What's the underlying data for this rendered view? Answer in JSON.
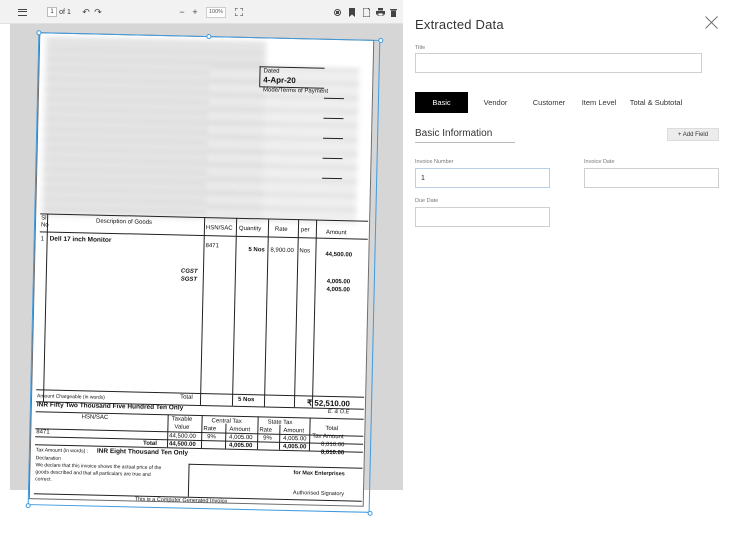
{
  "toolbar": {
    "page_current": "1",
    "page_of": "of 1",
    "zoom": "100%",
    "minus": "−",
    "plus": "+",
    "undo": "↶",
    "redo": "↷"
  },
  "document": {
    "dated_label": "Dated",
    "dated_value": "4-Apr-20",
    "mode_label": "Mode/Terms of Payment",
    "col_sl": "Sl",
    "col_no": "No",
    "col_desc": "Description of Goods",
    "col_hsn": "HSN/SAC",
    "col_qty": "Quantity",
    "col_rate": "Rate",
    "col_per": "per",
    "col_amount": "Amount",
    "item_no": "1",
    "item_desc": "Dell 17 inch Monitor",
    "item_hsn": "8471",
    "item_qty": "5 Nos",
    "item_rate": "8,900.00",
    "item_per": "Nos",
    "item_amount": "44,500.00",
    "cgst": "CGST",
    "sgst": "SGST",
    "cgst_amt": "4,005.00",
    "sgst_amt": "4,005.00",
    "total_label": "Total",
    "total_qty": "5 Nos",
    "total_amount": "₹ 52,510.00",
    "chargeable": "Amount Chargeable (in words)",
    "eoe": "E. & O.E",
    "words": "INR Fifty Two Thousand Five Hundred Ten Only",
    "t_hsn": "HSN/SAC",
    "t_taxable": "Taxable",
    "t_value": "Value",
    "t_central": "Central Tax",
    "t_state": "State Tax",
    "t_rate": "Rate",
    "t_amount": "Amount",
    "t_total": "Total",
    "t_taxamount": "Tax Amount",
    "t_hsn_val": "8471",
    "t_taxable_val": "44,500.00",
    "t_rate_val": "9%",
    "t_amt_val": "4,005.00",
    "t_total_val": "8,010.00",
    "t_total_label": "Total",
    "tax_words_label": "Tax Amount (in words) :",
    "tax_words": "INR Eight Thousand Ten Only",
    "declaration": "Declaration",
    "decl1": "We declare that this invoice shows the actual price of the",
    "decl2": "goods described and that all particulars are true and",
    "decl3": "correct.",
    "for_company": "for Max Enterprises",
    "signatory": "Authorised Signatory",
    "footer": "This is a Computer Generated Invoice"
  },
  "panel": {
    "title": "Extracted Data",
    "title_field_label": "Title",
    "title_value": "",
    "tabs": [
      {
        "label": "Basic"
      },
      {
        "label": "Vendor"
      },
      {
        "label": "Customer"
      },
      {
        "label": "Item Level"
      },
      {
        "label": "Total & Subtotal"
      }
    ],
    "section_title": "Basic Information",
    "add_field": "+ Add Field",
    "invoice_number_label": "Invoice Number",
    "invoice_number_value": "1",
    "invoice_date_label": "Invoice Date",
    "invoice_date_value": "",
    "due_date_label": "Due Date",
    "due_date_value": ""
  },
  "colors": {
    "accent_crop": "#3f9be0",
    "tab_active": "#000000"
  }
}
